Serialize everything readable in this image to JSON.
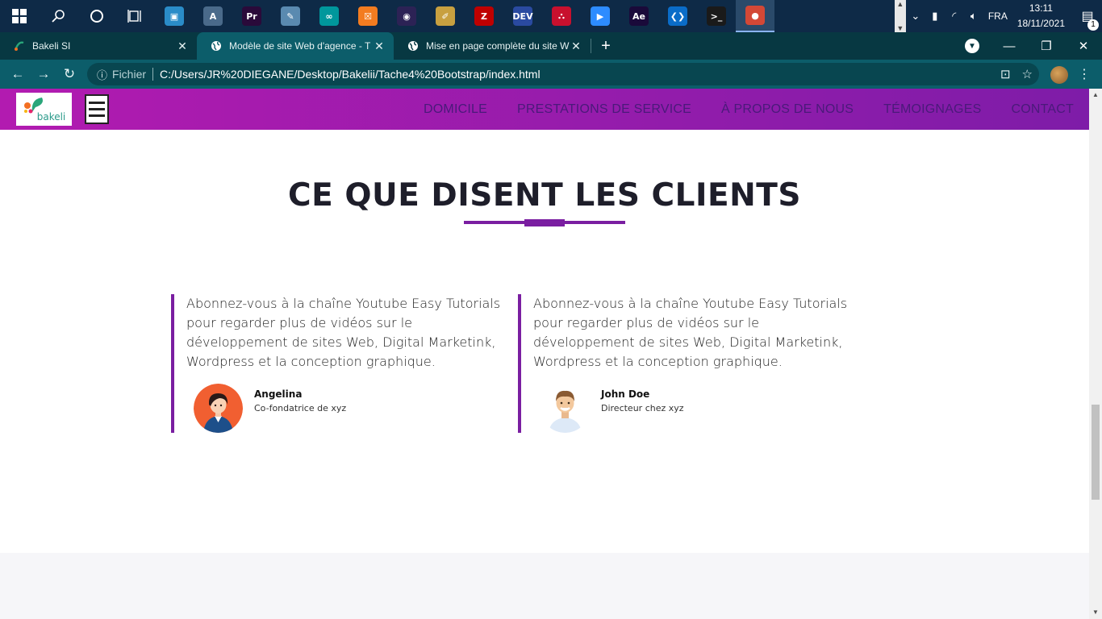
{
  "taskbar": {
    "apps": [
      {
        "name": "start",
        "glyph": "⊞"
      },
      {
        "name": "search",
        "glyph": "⚲"
      },
      {
        "name": "cortana",
        "glyph": "○"
      },
      {
        "name": "task-view",
        "glyph": "⧉"
      }
    ],
    "pinned": [
      {
        "id": "screen-app",
        "label": "▣",
        "color": "#2a8cc8"
      },
      {
        "id": "asp-app",
        "label": "A",
        "color": "#4a6a8a"
      },
      {
        "id": "premiere",
        "label": "Pr",
        "color": "#2a0a3a"
      },
      {
        "id": "notepad-app",
        "label": "✎",
        "color": "#5a8ab0"
      },
      {
        "id": "arduino",
        "label": "∞",
        "color": "#00979c"
      },
      {
        "id": "xampp",
        "label": "☒",
        "color": "#f37c20"
      },
      {
        "id": "eclipse",
        "label": "◉",
        "color": "#2c2255"
      },
      {
        "id": "pen-app",
        "label": "✐",
        "color": "#c8a040"
      },
      {
        "id": "filezilla",
        "label": "Z",
        "color": "#bf0000"
      },
      {
        "id": "devcpp",
        "label": "DEV",
        "color": "#2a4aa0"
      },
      {
        "id": "acrobat",
        "label": "⛬",
        "color": "#c8102e"
      },
      {
        "id": "zoom",
        "label": "▶",
        "color": "#2d8cff"
      },
      {
        "id": "after-effects",
        "label": "Ae",
        "color": "#1a0a3a"
      },
      {
        "id": "vscode",
        "label": "❮❯",
        "color": "#0a6cc8"
      },
      {
        "id": "terminal",
        "label": ">_",
        "color": "#1a1a1a"
      },
      {
        "id": "chrome",
        "label": "●",
        "color": "#d34836"
      }
    ],
    "tray": {
      "language": "FRA",
      "time": "13:11",
      "date": "18/11/2021",
      "notifications": "1"
    }
  },
  "browser": {
    "tabs": [
      {
        "title": "Bakeli SI",
        "favicon": "bakeli"
      },
      {
        "title": "Modèle de site Web d'agence - T",
        "favicon": "globe"
      },
      {
        "title": "Mise en page complète du site W",
        "favicon": "globe"
      }
    ],
    "new_tab": "+",
    "address": {
      "scheme": "Fichier",
      "url": "C:/Users/JR%20DIEGANE/Desktop/Bakelii/Tache4%20Bootstrap/index.html"
    }
  },
  "site": {
    "logo_text": "bakeli",
    "menu": [
      "DOMICILE",
      "PRESTATIONS DE SERVICE",
      "À PROPOS DE NOUS",
      "TÉMOIGNAGES",
      "CONTACT"
    ],
    "section_title": "CE QUE DISENT LES CLIENTS",
    "testimonials": [
      {
        "quote": "Abonnez-vous à la chaîne Youtube Easy Tutorials pour regarder plus de vidéos sur le développement de sites Web, Digital Marketink, Wordpress et la conception graphique.",
        "name": "Angelina",
        "role": "Co-fondatrice de xyz"
      },
      {
        "quote": "Abonnez-vous à la chaîne Youtube Easy Tutorials pour regarder plus de vidéos sur le développement de sites Web, Digital Marketink, Wordpress et la conception graphique.",
        "name": "John Doe",
        "role": "Directeur chez xyz"
      }
    ],
    "accent_color": "#7a1ea1",
    "nav_gradient": [
      "#b21bb0",
      "#7e1ca8"
    ]
  }
}
